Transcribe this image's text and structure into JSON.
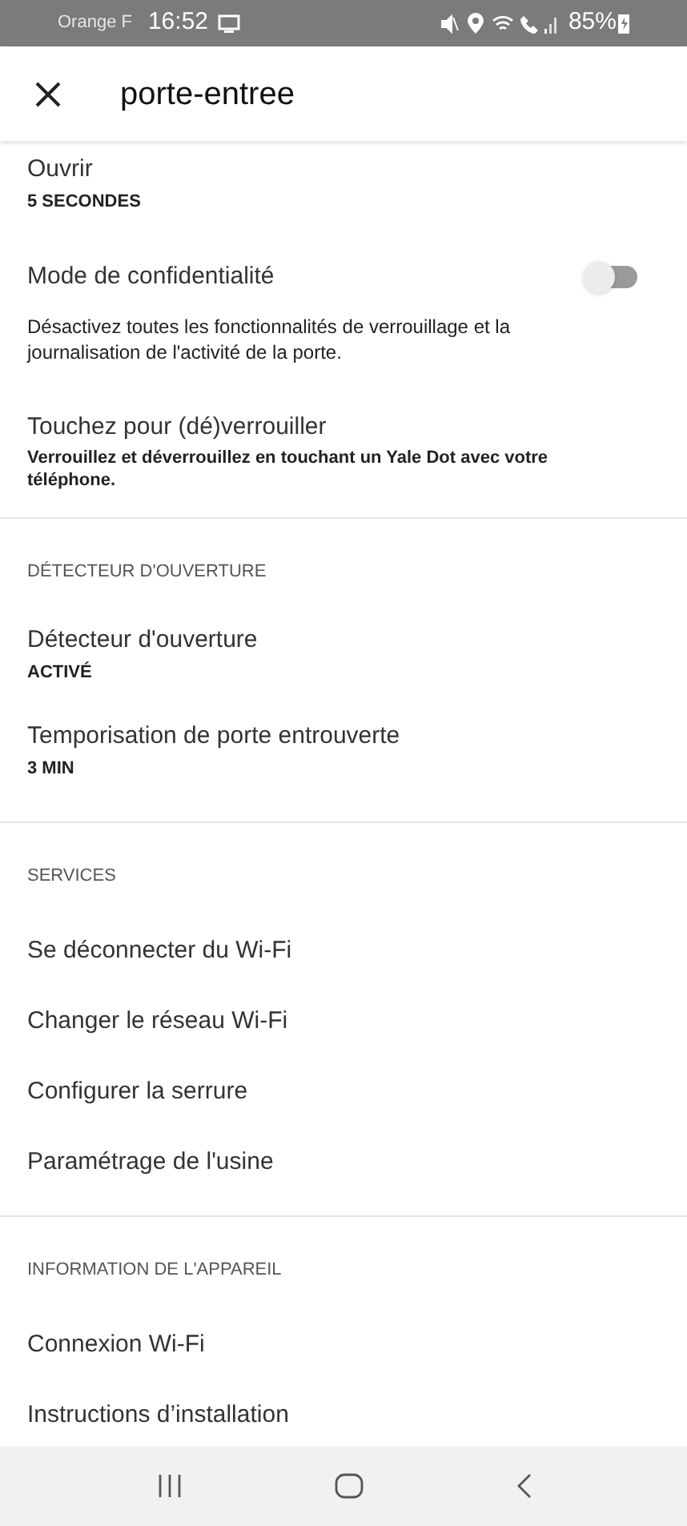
{
  "status_bar": {
    "carrier": "Orange F",
    "time": "16:52",
    "battery": "85%"
  },
  "header": {
    "title": "porte-entree"
  },
  "sections": [
    {
      "items": [
        {
          "kind": "value",
          "title": "Ouvrir",
          "value": "5 SECONDES"
        },
        {
          "kind": "toggle",
          "title": "Mode de confidentialité",
          "on": false,
          "description": "Désactivez toutes les fonctionnalités de verrouillage et la journalisation de l'activité de la porte."
        },
        {
          "kind": "note",
          "title": "Touchez pour (dé)verrouiller",
          "description": "Verrouillez et déverrouillez en touchant un Yale Dot avec votre téléphone."
        }
      ]
    },
    {
      "header": "DÉTECTEUR D'OUVERTURE",
      "items": [
        {
          "kind": "value",
          "title": "Détecteur d'ouverture",
          "value": "ACTIVÉ"
        },
        {
          "kind": "value",
          "title": "Temporisation de porte entrouverte",
          "value": "3 MIN"
        }
      ]
    },
    {
      "header": "SERVICES",
      "items": [
        {
          "kind": "link",
          "title": "Se déconnecter du Wi-Fi"
        },
        {
          "kind": "link",
          "title": "Changer le réseau Wi-Fi"
        },
        {
          "kind": "link",
          "title": "Configurer la serrure"
        },
        {
          "kind": "link",
          "title": "Paramétrage de l'usine"
        }
      ]
    },
    {
      "header": "INFORMATION DE L'APPAREIL",
      "items": [
        {
          "kind": "link",
          "title": "Connexion Wi-Fi"
        },
        {
          "kind": "link",
          "title": "Instructions d’installation"
        }
      ]
    }
  ]
}
